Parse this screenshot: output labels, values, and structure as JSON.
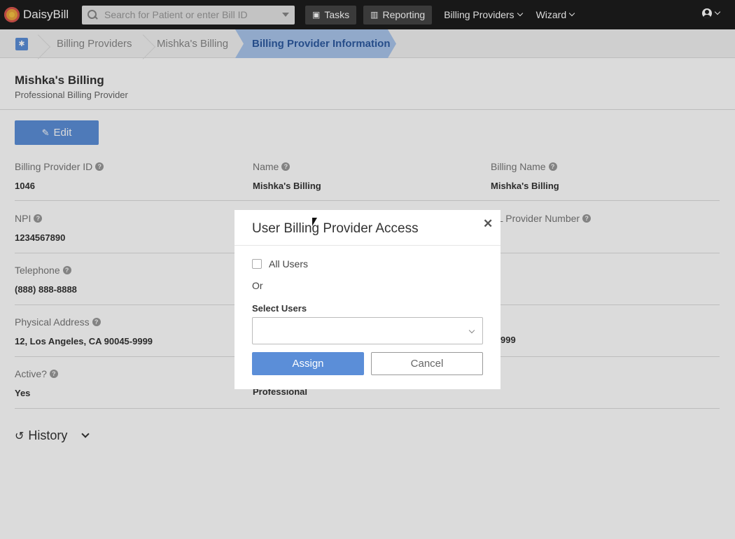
{
  "app": {
    "name": "DaisyBill"
  },
  "topnav": {
    "search_placeholder": "Search for Patient or enter Bill ID",
    "tasks_label": "Tasks",
    "reporting_label": "Reporting",
    "billing_providers_label": "Billing Providers",
    "wizard_label": "Wizard"
  },
  "breadcrumb": {
    "items": [
      "Billing Providers",
      "Mishka's Billing"
    ],
    "active": "Billing Provider Information"
  },
  "page": {
    "title": "Mishka's Billing",
    "subtitle": "Professional Billing Provider",
    "edit_label": "Edit"
  },
  "fields": {
    "billing_provider_id": {
      "label": "Billing Provider ID",
      "value": "1046"
    },
    "name": {
      "label": "Name",
      "value": "Mishka's Billing"
    },
    "billing_name": {
      "label": "Billing Name",
      "value": "Mishka's Billing"
    },
    "npi": {
      "label": "NPI",
      "value": "1234567890"
    },
    "dl_provider_number": {
      "label": "DL Provider Number",
      "value": ""
    },
    "telephone": {
      "label": "Telephone",
      "value": "(888) 888-8888"
    },
    "physical_address": {
      "label": "Physical Address",
      "value": "12, Los Angeles, CA 90045-9999"
    },
    "partial_right": {
      "value": "999"
    },
    "active": {
      "label": "Active?",
      "value": "Yes"
    },
    "type_value": {
      "value": "Professional"
    }
  },
  "history": {
    "label": "History"
  },
  "modal": {
    "title": "User Billing Provider Access",
    "all_users_label": "All Users",
    "all_users_checked": false,
    "or_label": "Or",
    "select_users_label": "Select Users",
    "select_users_value": "",
    "assign_label": "Assign",
    "cancel_label": "Cancel"
  },
  "colors": {
    "primary": "#5b8ed8",
    "nav_bg": "#1c1c1c",
    "breadcrumb_active_bg": "#a9c5ec"
  }
}
